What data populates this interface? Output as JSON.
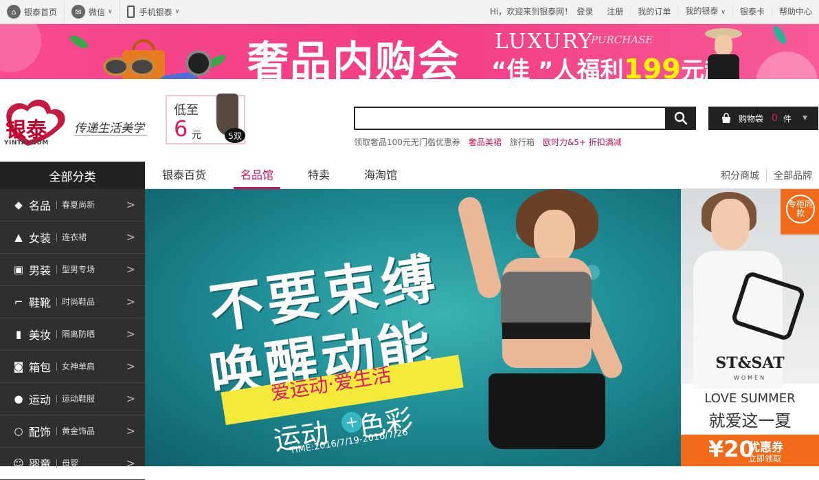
{
  "topbar": {
    "home": "银泰首页",
    "wechat": "微信",
    "mobile": "手机银泰",
    "welcome": "Hi，欢迎来到银泰网！",
    "login": "登录",
    "register": "注册",
    "orders": "我的订单",
    "my_yintai": "我的银泰",
    "card": "银泰卡",
    "help": "帮助中心"
  },
  "banner": {
    "title": "奢品内购会",
    "luxury": "LUXURY",
    "purchase": "PURCHASE",
    "subtitle_prefix": "“佳 ”人福利",
    "price": "199",
    "subtitle_suffix": "元起"
  },
  "header": {
    "logo_text": "银泰",
    "logo_url": "YINTAI.COM",
    "slogan": "传递生活美学",
    "promo": {
      "line1": "低至",
      "price": "6",
      "unit": "元",
      "pairs": "5双"
    },
    "search": {
      "value": "",
      "placeholder": ""
    },
    "hotwords": [
      "领取奢品100元无门槛优惠券",
      "奢品美裙",
      "旅行箱",
      "欧时力&5+ 折扣满减"
    ],
    "cart": {
      "label": "购物袋",
      "count": "0",
      "unit": "件"
    }
  },
  "nav": {
    "all_categories": "全部分类",
    "tabs": [
      "银泰百货",
      "名品馆",
      "特卖",
      "海淘馆"
    ],
    "right_links": [
      "积分商城",
      "全部品牌"
    ]
  },
  "categories": [
    {
      "icon": "diamond-icon",
      "name": "名品",
      "sub": "春夏尚新"
    },
    {
      "icon": "dress-icon",
      "name": "女装",
      "sub": "连衣裙"
    },
    {
      "icon": "shirt-icon",
      "name": "男装",
      "sub": "型男专场"
    },
    {
      "icon": "heel-icon",
      "name": "鞋靴",
      "sub": "时尚鞋品"
    },
    {
      "icon": "cosmetic-icon",
      "name": "美妆",
      "sub": "隔离防晒"
    },
    {
      "icon": "bag-icon",
      "name": "箱包",
      "sub": "女神单肩"
    },
    {
      "icon": "ball-icon",
      "name": "运动",
      "sub": "运动鞋服"
    },
    {
      "icon": "ring-icon",
      "name": "配饰",
      "sub": "黄金饰品"
    },
    {
      "icon": "baby-icon",
      "name": "婴童",
      "sub": "母婴"
    }
  ],
  "hero": {
    "line1": "不要束缚",
    "line2": "唤醒动能",
    "line3": "爱运动·爱生活",
    "line4a": "运动",
    "line4b": "色彩",
    "time": "TIME:2016/7/19-2016/7/26"
  },
  "side_ad": {
    "tag": "专柜同款",
    "brand": "ST&SAT",
    "brand_sub": "WOMEN",
    "love": "LOVE SUMMER",
    "love_cn": "就爱这一夏",
    "coupon_amount": "¥20",
    "coupon_title": "优惠券",
    "coupon_action": "立即领取"
  }
}
